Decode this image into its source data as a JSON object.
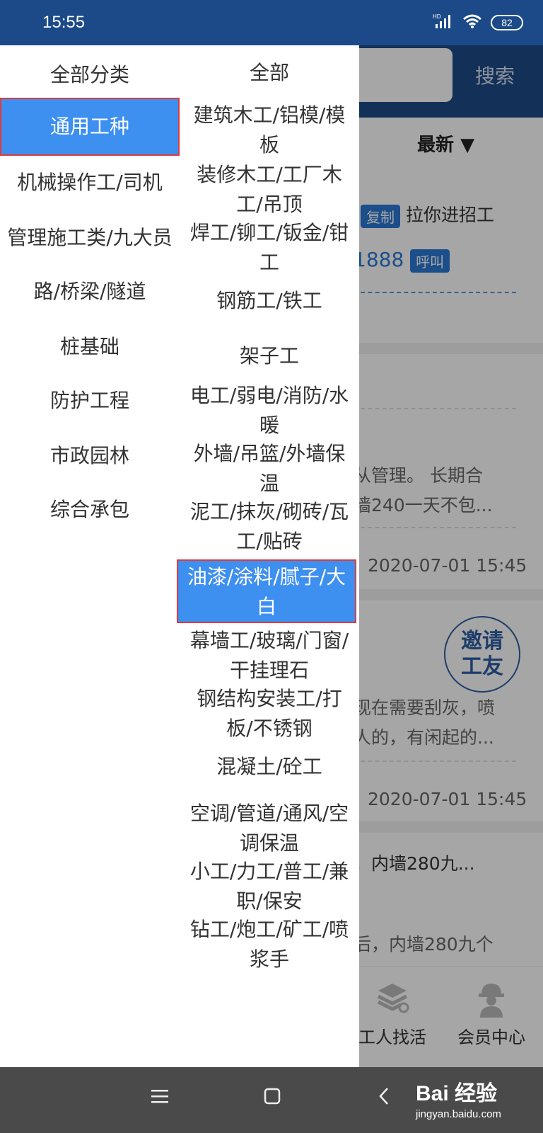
{
  "status_bar": {
    "time": "15:55",
    "hd": "HD",
    "battery": "82"
  },
  "background": {
    "search_button": "搜索",
    "filter_label": "最新",
    "lines": [
      {
        "text": "拉你进招工",
        "pill": "复制"
      },
      {
        "text": "1888",
        "pill": "呼叫"
      },
      {
        "text": "从管理。 长期合"
      },
      {
        "text": "墙240一天不包..."
      },
      {
        "text": "2020-07-01 15:45"
      },
      {
        "text": "现在需要刮灰，喷"
      },
      {
        "text": "人的，有闲起的..."
      },
      {
        "text": "2020-07-01 15:45"
      },
      {
        "text": "，内墙280九..."
      },
      {
        "text": "后，内墙280九个"
      }
    ],
    "invite_seal": [
      "邀请",
      "工友"
    ],
    "bottom_nav": [
      {
        "label": "工人找活",
        "icon": "books-search-icon"
      },
      {
        "label": "会员中心",
        "icon": "worker-helmet-icon"
      }
    ]
  },
  "drawer": {
    "left_header": "全部分类",
    "categories": [
      {
        "label": "通用工种",
        "selected": true
      },
      {
        "label": "机械操作工/司机"
      },
      {
        "label": "管理施工类/九大员"
      },
      {
        "label": "路/桥梁/隧道"
      },
      {
        "label": "桩基础"
      },
      {
        "label": "防护工程"
      },
      {
        "label": "市政园林"
      },
      {
        "label": "综合承包"
      }
    ],
    "right_header": "全部",
    "subcategories": [
      {
        "lines": [
          "建筑木工/铝模/模",
          "板"
        ]
      },
      {
        "lines": [
          "装修木工/工厂木",
          "工/吊顶"
        ]
      },
      {
        "lines": [
          "焊工/铆工/钣金/钳",
          "工"
        ]
      },
      {
        "lines": [
          "钢筋工/铁工"
        ]
      },
      {
        "lines": [
          "架子工"
        ]
      },
      {
        "lines": [
          "电工/弱电/消防/水",
          "暖"
        ]
      },
      {
        "lines": [
          "外墙/吊篮/外墙保",
          "温"
        ]
      },
      {
        "lines": [
          "泥工/抹灰/砌砖/瓦",
          "工/贴砖"
        ]
      },
      {
        "lines": [
          "油漆/涂料/腻子/大",
          "白"
        ],
        "selected": true
      },
      {
        "lines": [
          "幕墙工/玻璃/门窗/",
          "干挂理石"
        ]
      },
      {
        "lines": [
          "钢结构安装工/打",
          "板/不锈钢"
        ]
      },
      {
        "lines": [
          "混凝土/砼工"
        ]
      },
      {
        "lines": [
          "空调/管道/通风/空",
          "调保温"
        ]
      },
      {
        "lines": [
          "小工/力工/普工/兼",
          "职/保安"
        ]
      },
      {
        "lines": [
          "钻工/炮工/矿工/喷",
          "浆手"
        ]
      }
    ]
  },
  "system_nav": {
    "watermark_main": "Bai 经验",
    "watermark_sub": "jingyan.baidu.com"
  },
  "colors": {
    "header_blue": "#1c4a88",
    "highlight_blue": "#3d8ff0",
    "outline_red": "#e03a3a"
  }
}
